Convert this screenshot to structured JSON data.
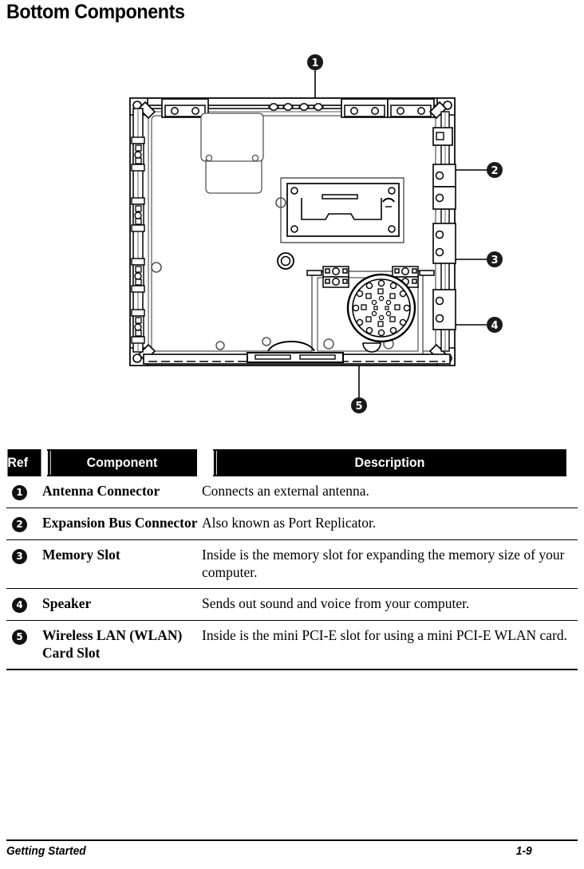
{
  "page": {
    "title": "Bottom Components"
  },
  "figure": {
    "name": "bottom-view-diagram",
    "description": "Line drawing of the bottom side of a notebook computer with five numbered callouts",
    "callouts": [
      {
        "number": "1",
        "target": "antenna-connector"
      },
      {
        "number": "2",
        "target": "expansion-bus-connector"
      },
      {
        "number": "3",
        "target": "memory-slot"
      },
      {
        "number": "4",
        "target": "speaker"
      },
      {
        "number": "5",
        "target": "wireless-lan-card-slot"
      }
    ]
  },
  "table": {
    "headers": {
      "ref": "Ref",
      "component": "Component",
      "description": "Description"
    },
    "rows": [
      {
        "ref": "1",
        "component": "Antenna Connector",
        "description": "Connects an external antenna."
      },
      {
        "ref": "2",
        "component": "Expansion Bus Connector",
        "description": "Also known as Port Replicator."
      },
      {
        "ref": "3",
        "component": "Memory Slot",
        "description": "Inside is the memory slot for expanding the memory size of your computer."
      },
      {
        "ref": "4",
        "component": "Speaker",
        "description": "Sends out sound and voice from your computer."
      },
      {
        "ref": "5",
        "component": "Wireless LAN (WLAN) Card Slot",
        "description": "Inside is the mini PCI-E slot for using a mini PCI-E WLAN card."
      }
    ]
  },
  "footer": {
    "section": "Getting Started",
    "page_number": "1-9"
  }
}
